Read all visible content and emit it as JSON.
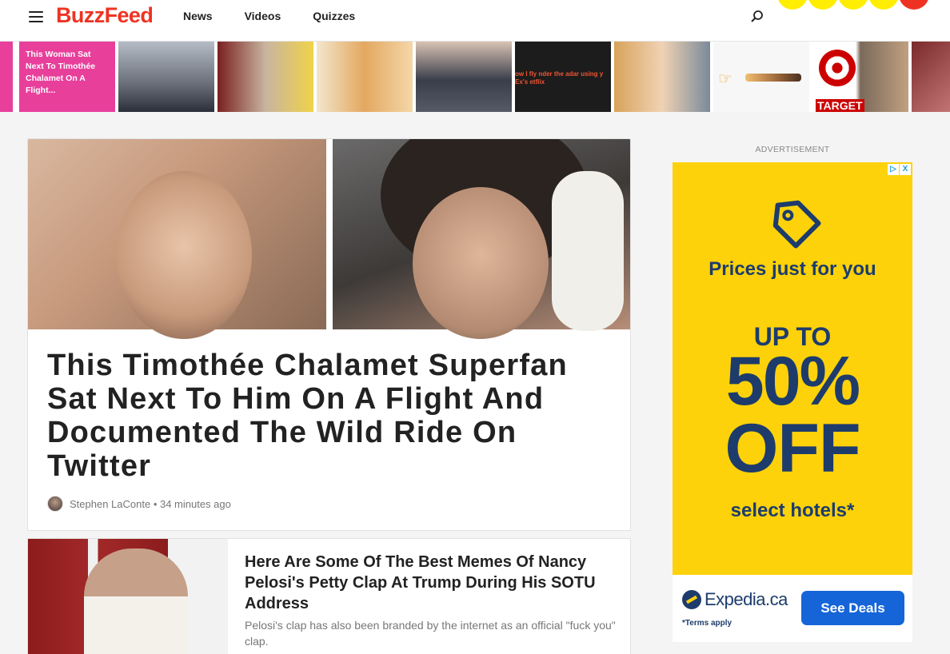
{
  "header": {
    "logo": "BuzzFeed",
    "nav": [
      "News",
      "Videos",
      "Quizzes"
    ]
  },
  "trending": {
    "items": [
      {
        "caption": "This Woman Sat Next To Timothée Chalamet On A Flight...",
        "bg": "#e83f9b"
      },
      {
        "caption": "",
        "bg": "#9aa3ad"
      },
      {
        "caption": "",
        "bg": "#9c2b2b"
      },
      {
        "caption": "",
        "bg": "#e7c07a"
      },
      {
        "caption": "",
        "bg": "#4b4f5c"
      },
      {
        "caption": "ow I fly nder the adar using y Ex's etflix",
        "bg": "#1c1c1c"
      },
      {
        "caption": "",
        "bg": "#d8a35a"
      },
      {
        "caption": "",
        "bg": "#f4f4f4"
      },
      {
        "caption": "TARGET",
        "bg": "#e2e2e2"
      },
      {
        "caption": "",
        "bg": "#7a2a2a"
      }
    ]
  },
  "main_story": {
    "title": "This Timothée Chalamet Superfan Sat Next To Him On A Flight And Documented The Wild Ride On Twitter",
    "author": "Stephen LaConte",
    "time": "34 minutes ago",
    "separator": " • "
  },
  "second_story": {
    "title": "Here Are Some Of The Best Memes Of Nancy Pelosi's Petty Clap At Trump During His SOTU Address",
    "description": "Pelosi's clap has also been branded by the internet as an official \"fuck you\" clap."
  },
  "ad": {
    "label": "ADVERTISEMENT",
    "tagline": "Prices just for you",
    "up_to": "UP TO",
    "percent": "50%",
    "off": "OFF",
    "select": "select hotels*",
    "brand": "Expedia.ca",
    "terms": "*Terms apply",
    "cta": "See Deals",
    "adchoices": "▷",
    "close": "X",
    "colors": {
      "background": "#fdd20b",
      "text": "#1d3c6c",
      "button": "#1565d8"
    }
  }
}
